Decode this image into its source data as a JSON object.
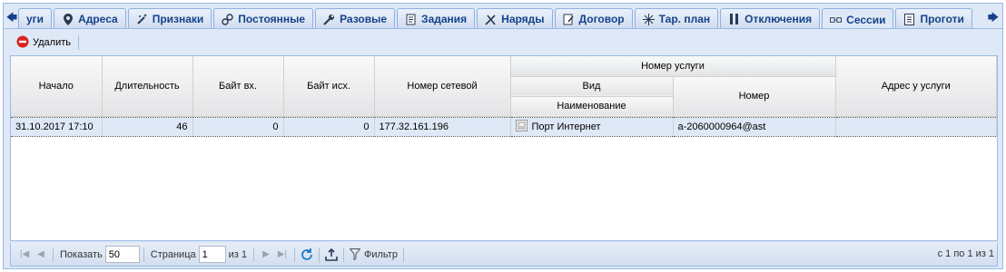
{
  "tabs": [
    {
      "label": "уги",
      "icon": "arrow-left-icon"
    },
    {
      "label": "Адреса",
      "icon": "map-pin-icon"
    },
    {
      "label": "Признаки",
      "icon": "magic-wand-icon"
    },
    {
      "label": "Постоянные",
      "icon": "link-icon"
    },
    {
      "label": "Разовые",
      "icon": "wrench-icon"
    },
    {
      "label": "Задания",
      "icon": "script-icon"
    },
    {
      "label": "Наряды",
      "icon": "tools-icon"
    },
    {
      "label": "Договор",
      "icon": "document-edit-icon"
    },
    {
      "label": "Тар. план",
      "icon": "sparkle-icon"
    },
    {
      "label": "Отключения",
      "icon": "pause-icon"
    },
    {
      "label": "Сессии",
      "icon": "connection-icon"
    },
    {
      "label": "Проготи",
      "icon": "page-icon"
    }
  ],
  "active_tab": "Сессии",
  "toolbar": {
    "delete_label": "Удалить"
  },
  "columns": {
    "start": "Начало",
    "duration": "Длительность",
    "bytes_in": "Байт вх.",
    "bytes_out": "Байт исх.",
    "network_number": "Номер сетевой",
    "service_number_group": "Номер услуги",
    "kind": "Вид",
    "name": "Наименование",
    "number": "Номер",
    "address": "Адрес у услуги"
  },
  "rows": [
    {
      "start": "31.10.2017 17:10",
      "duration": "46",
      "bytes_in": "0",
      "bytes_out": "0",
      "network_number": "177.32.161.196",
      "service_name": "Порт Интернет",
      "number": "a-2060000964@ast",
      "address": ""
    }
  ],
  "pager": {
    "show_label": "Показать",
    "page_size": "50",
    "page_label": "Страница",
    "page": "1",
    "of_label": "из 1",
    "filter_label": "Фильтр",
    "summary": "с 1 по 1 из 1"
  },
  "colors": {
    "accent": "#15428b",
    "border": "#99bbe8",
    "delete": "#d9231f"
  }
}
